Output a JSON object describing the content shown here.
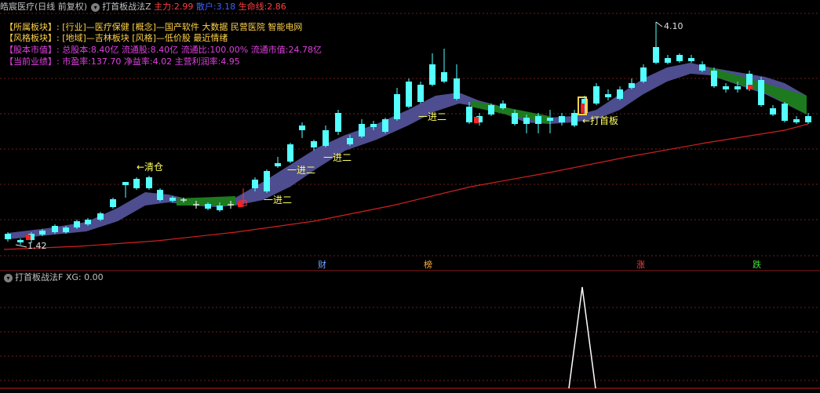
{
  "header": {
    "stock_name": "皓宸医疗",
    "period": "(日线 前复权)",
    "indicator": "打首板战法Z",
    "main_label": "主力:",
    "main_value": "2.99",
    "retail_label": "散户:",
    "retail_value": "3.18",
    "life_label": "生命线:",
    "life_value": "2.86"
  },
  "info": {
    "line1_label": "【所属板块】:",
    "line1_value": "[行业]—医疗保健 [概念]—国产软件 大数据 民营医院 智能电网",
    "line2_label": "【风格板块】:",
    "line2_value": "[地域]—吉林板块 [风格]—低价股 最近情绪",
    "line3_label": "【股本市值】:",
    "line3_value": "总股本:8.40亿 流通股:8.40亿 流通比:100.00% 流通市值:24.78亿",
    "line4_label": "【当前业绩】:",
    "line4_value": "市盈率:137.70 净益率:4.02 主营利润率:4.95"
  },
  "annotations": {
    "high": "4.10",
    "low": "1.42",
    "qingcang": "←清仓",
    "jiner": "一进二",
    "dashouban": "←打首板"
  },
  "markers": {
    "cai": "财",
    "bang": "榜",
    "zhang": "涨",
    "die": "跌"
  },
  "sub": {
    "title": "打首板战法F",
    "xg_label": "XG:",
    "xg_value": "0.00"
  },
  "colors": {
    "up": "#ff3232",
    "down": "#54ffff",
    "ribbon_up": "#5a5aa8",
    "ribbon_down": "#1e7a1e",
    "life_line": "#d02020",
    "grid": "#6e1e1e"
  }
}
